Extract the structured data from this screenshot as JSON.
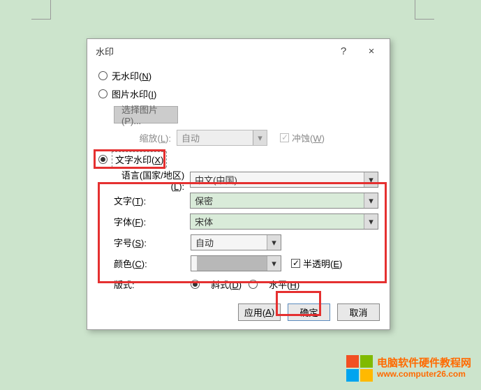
{
  "dialog": {
    "title": "水印",
    "help_icon": "?",
    "close_icon": "×",
    "no_watermark": {
      "label": "无水印(",
      "mnemonic": "N",
      "suffix": ")"
    },
    "picture_watermark": {
      "label": "图片水印(",
      "mnemonic": "I",
      "suffix": ")"
    },
    "select_picture_btn": "选择图片(P)...",
    "scale": {
      "label": "缩放(",
      "mnemonic": "L",
      "suffix": "):",
      "value": "自动"
    },
    "washout": {
      "label": "冲蚀(",
      "mnemonic": "W",
      "suffix": ")"
    },
    "text_watermark": {
      "label": "文字水印(",
      "mnemonic": "X",
      "suffix": ")"
    },
    "language": {
      "label": "语言(国家/地区)(",
      "mnemonic": "L",
      "suffix": "):",
      "value": "中文(中国)"
    },
    "text": {
      "label": "文字(",
      "mnemonic": "T",
      "suffix": "):",
      "value": "保密"
    },
    "font": {
      "label": "字体(",
      "mnemonic": "F",
      "suffix": "):",
      "value": "宋体"
    },
    "size": {
      "label": "字号(",
      "mnemonic": "S",
      "suffix": "):",
      "value": "自动"
    },
    "color": {
      "label": "颜色(",
      "mnemonic": "C",
      "suffix": "):"
    },
    "semitransparent": {
      "label": "半透明(",
      "mnemonic": "E",
      "suffix": ")"
    },
    "layout": {
      "label": "版式:",
      "diagonal": "斜式(",
      "diagonal_m": "D",
      "diagonal_s": ")",
      "horizontal": "水平(",
      "horizontal_m": "H",
      "horizontal_s": ")"
    },
    "buttons": {
      "apply": "应用(",
      "apply_m": "A",
      "apply_s": ")",
      "ok": "确定",
      "cancel": "取消"
    }
  },
  "watermark_site": {
    "line1": "电脑软件硬件教程网",
    "line2": "www.computer26.com"
  }
}
